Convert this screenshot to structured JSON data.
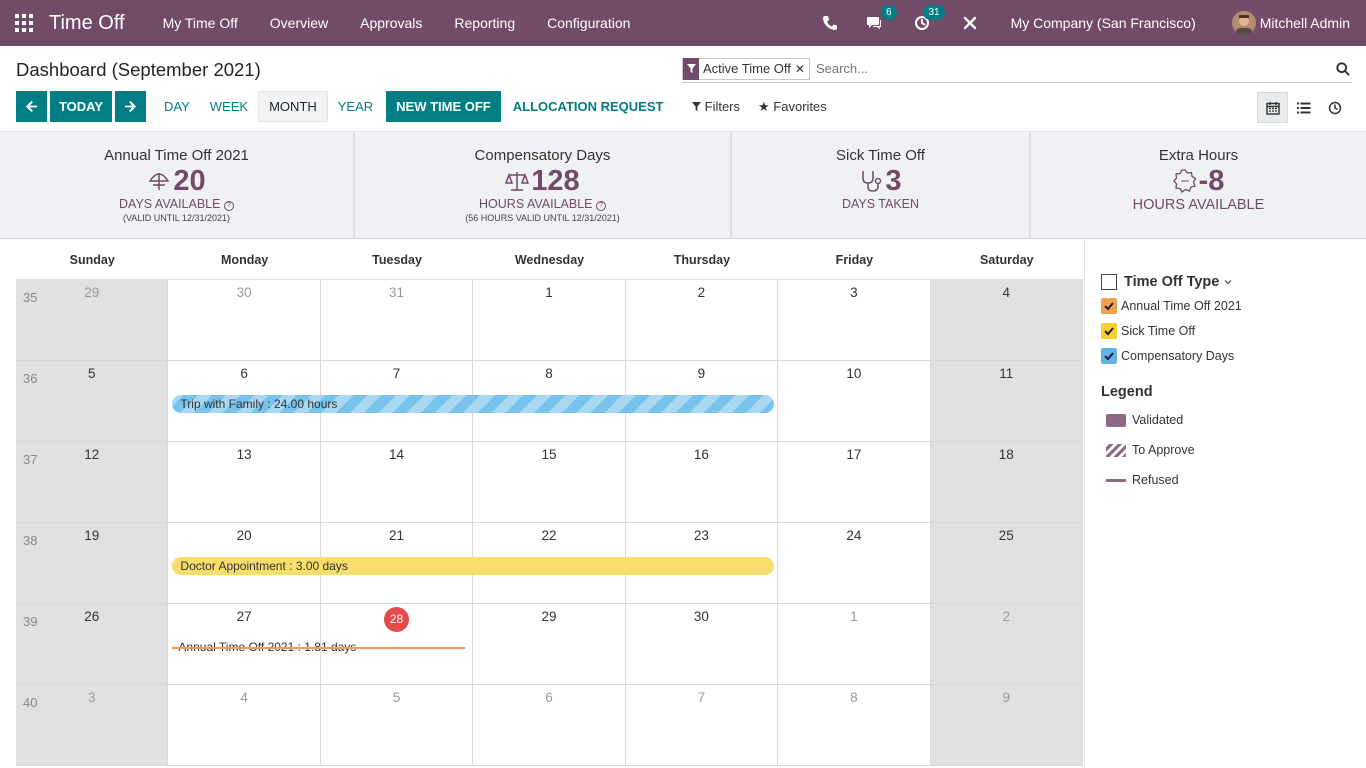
{
  "app": {
    "title": "Time Off"
  },
  "menu": [
    "My Time Off",
    "Overview",
    "Approvals",
    "Reporting",
    "Configuration"
  ],
  "systray": {
    "messages_count": "6",
    "activities_count": "31",
    "company": "My Company (San Francisco)",
    "user": "Mitchell Admin"
  },
  "page": {
    "title": "Dashboard (September 2021)"
  },
  "search": {
    "facet": "Active Time Off",
    "placeholder": "Search..."
  },
  "toolbar": {
    "today": "TODAY",
    "day": "DAY",
    "week": "WEEK",
    "month": "MONTH",
    "year": "YEAR",
    "new_time_off": "NEW TIME OFF",
    "allocation_request": "ALLOCATION REQUEST",
    "filters": "Filters",
    "favorites": "Favorites"
  },
  "stats": [
    {
      "title": "Annual Time Off 2021",
      "value": "20",
      "unit": "DAYS AVAILABLE",
      "note": "(VALID UNTIL 12/31/2021)",
      "icon": "umbrella-icon"
    },
    {
      "title": "Compensatory Days",
      "value": "128",
      "unit": "HOURS AVAILABLE",
      "note": "(56 HOURS VALID UNTIL 12/31/2021)",
      "icon": "scale-icon"
    },
    {
      "title": "Sick Time Off",
      "value": "3",
      "unit": "DAYS TAKEN",
      "note": "",
      "icon": "stethoscope-icon"
    },
    {
      "title": "Extra Hours",
      "value": "-8",
      "unit": "HOURS AVAILABLE",
      "note": "",
      "icon": "extra-hours-badge-icon"
    }
  ],
  "calendar": {
    "weekdays": [
      "Sunday",
      "Monday",
      "Tuesday",
      "Wednesday",
      "Thursday",
      "Friday",
      "Saturday"
    ],
    "weeks": [
      {
        "num": "35",
        "days": [
          "29",
          "30",
          "31",
          "1",
          "2",
          "3",
          "4"
        ]
      },
      {
        "num": "36",
        "days": [
          "5",
          "6",
          "7",
          "8",
          "9",
          "10",
          "11"
        ]
      },
      {
        "num": "37",
        "days": [
          "12",
          "13",
          "14",
          "15",
          "16",
          "17",
          "18"
        ]
      },
      {
        "num": "38",
        "days": [
          "19",
          "20",
          "21",
          "22",
          "23",
          "24",
          "25"
        ]
      },
      {
        "num": "39",
        "days": [
          "26",
          "27",
          "28",
          "29",
          "30",
          "1",
          "2"
        ]
      },
      {
        "num": "40",
        "days": [
          "3",
          "4",
          "5",
          "6",
          "7",
          "8",
          "9"
        ]
      }
    ],
    "events": {
      "trip": "Trip with Family : 24.00 hours",
      "doctor": "Doctor Appointment : 3.00 days",
      "annual": "Annual Time Off 2021 : 1.81 days"
    }
  },
  "sidepanel": {
    "filter_title": "Time Off Type",
    "types": [
      {
        "label": "Annual Time Off 2021",
        "color": "#f0a050"
      },
      {
        "label": "Sick Time Off",
        "color": "#f6d02f"
      },
      {
        "label": "Compensatory Days",
        "color": "#5fb3e6"
      }
    ],
    "legend_title": "Legend",
    "legend": [
      "Validated",
      "To Approve",
      "Refused"
    ]
  }
}
